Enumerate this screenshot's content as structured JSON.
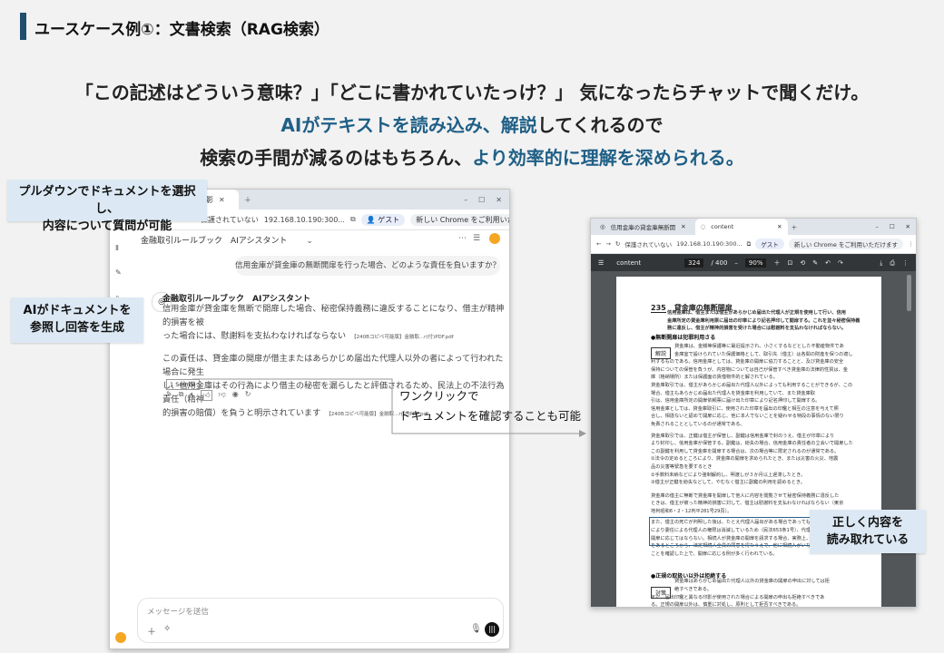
{
  "header": {
    "title": "ユースケース例①：文書検索（RAG検索）"
  },
  "headline": {
    "line1": "「この記述はどういう意味？」「どこに書かれていたっけ？」 気になったらチャットで聞くだけ。",
    "line2_a": "AIがテキストを読み込み、",
    "line2_b": "解説",
    "line2_c": "してくれるので",
    "line3_a": "検索の手間が減るのはもちろん、",
    "line3_b": "より効率的に理解を深められる。"
  },
  "callouts": {
    "dropdown": "プルダウンでドキュメントを選択し、\n内容について質問が可能",
    "ai_ref": "AIがドキュメントを\n参照し回答を生成",
    "one_click": "ワンクリックで\nドキュメントを確認することも可能",
    "correct": "正しく内容を\n読み取れている"
  },
  "chat_window": {
    "tab_label": "影",
    "url_insecure": "保護されていない",
    "url": "192.168.10.190:300...",
    "guest": "ゲスト",
    "chrome_notice": "新しい Chrome をご利用いただけます",
    "dropdown_label": "金融取引ルールブック　AIアシスタント",
    "user_question": "信用金庫が貸金庫の無断開扉を行った場合、どのような責任を負いますか？",
    "assistant_name": "金融取引ルールブック　AIアシスタント",
    "answer_p1a": "信用金庫が貸金庫を無断で開扉した場合、秘密保持義務に違反することになり、借主が精神的損害を被",
    "answer_p1b": "った場合には、慰謝料を支払わなければならない",
    "source_tag1": "【240Bコピペ可能版】金融取...r(付)PDF.pdf",
    "answer_p2a": "この責任は、貸金庫の開扉が借主またはあらかじめ届出た代理人以外の者によって行われた場合に発生",
    "answer_p2b": "し、信用金庫はその行為により借主の秘密を漏らしたと評価されるため、民法上の不法行為責任（精神",
    "answer_p2c": "的損害の賠償）を負うと明示されています",
    "source_tag2": "【240Bコピペ可能版】金融取...r(付)PDF.pdf",
    "sources_button": "1 Source",
    "message_placeholder": "メッセージを送信"
  },
  "pdf_window": {
    "tab1": "信用金庫の貸金庫無断開",
    "tab2": "content",
    "url_insecure": "保護されていない",
    "url": "192.168.10.190:300...",
    "guest": "ゲスト",
    "chrome_notice": "新しい Chrome をご利用いただけます",
    "doc_title": "content",
    "page_current": "324",
    "page_total": "/ 400",
    "zoom": "90%",
    "section_no": "235",
    "section_title": "貸金庫の無断開扉",
    "intro1": "信用金庫は、借主または借主があらかじめ届出た代理人が正規を使用して行い、信用",
    "intro2": "金庫所定の貸金庫利用票に届出の印章により記名押印して開扉する。これを並々秘密保持義",
    "intro3": "務に違反し、借主が精神的損害を受けた場合には慰謝料を支払わなければならない。",
    "bullet1": "●無断開扉は犯罪利用さる",
    "kaisetsu_tag": "解説",
    "taisaku_tag": "対策",
    "bullet2": "●正規の取扱い以外は拒絶する",
    "body_lines": [
      "貸金庫は、金銭等保護等に最近提示され、小さくするなどとした不動産物件であ",
      "金庫室で設けられていた保護価格として、取引先（借主）は各間の財産を保つの適し",
      "利するものである。信用金庫としては、貸金庫の開扉に協力することと、及び貸金庫の安全",
      "保持についての保管を負うが、内容物については自己が保管すべき貸金庫の法律的性質は、金",
      "庫（格納場所）または保護面の賃借物件的と解されている。",
      "貸金庫取引では、借主があらかじめ届出た代理人以外によっても利用することができるが、この",
      "場合、借主もあらかじめ届出た代理人を貸金庫を利用していて、また貸金庫取",
      "引は、信用金庫所定の開扉依頼票に届け出た印章により記名押印して開扉する。",
      "信用金庫としては、貸金庫取引に、使用された印章を届出の印鑑と相互の注意を与えて照",
      "合し、相違ないと認めて開扉に応じ、他に本人でないことを疑わせる特段の事情のない限り",
      "免責されることとしているのが通常である。",
      "貸金庫取引では、正鍵は借主が保管し、副鍵は信用金庫で封のうえ、借主が印章により",
      "より封印し、信用金庫が保管する。副鍵は、紛失の場合、信用金庫の責任者の立会いで開扉した",
      "この副鍵を利用して貸金庫を開扉する場合は、次の場合等に限定されるのが通常である。",
      "①法令の定めるところにより、貸金庫の開扉を求められたとき、または災害の火災、地震",
      "品の災害等緊急を要するとき",
      "②手数料未納などにより強制解約し、明渡しが３か月以上遅滞したとき。",
      "③借主が正鍵を紛失などして、やむなく借主に副鍵の利用を認めるとき。",
      "貸金庫の借主に無断で貸金庫を開扉して他人に内容を閲覧させて秘密保持義務に違反した",
      "ときは、借主が被った精神的損害に対して、借主は慰謝料を支払わなければならない（東京",
      "地判昭和6・2・12判平281号29頁）。",
      "また、借主の死亡が判明した後は、たとえ代理人届出がある場合であっても、本人の死亡に",
      "により委任による代理人の権限は消滅しているため（民法653条1号）、代理人による",
      "開扉に応じてはならない。相続人が貸金庫の開扉を請求する場合、実務上、相続",
      "をあるところから、法定相続人全員の同意を得たうえで、他に相続人がいない",
      "ことを確認した上で、開扉に応じる例が多く行われている。",
      "貸金庫はあらかじめ届出た代理人以外の貸金庫の開扉の申出に対しては拒",
      "絶すべきである。",
      "また、届出印鑑と異なる印影が使用された場合による開扉の申出も拒絶すべきであ",
      "る。正規の開扉以外は、慎重に対処し、原則として拒否すべきである。"
    ]
  },
  "colors": {
    "accent": "#1f5f86",
    "header_bar": "#1f4e6e",
    "callout_bg": "#dce9f4",
    "background": "#f2f2f2"
  }
}
